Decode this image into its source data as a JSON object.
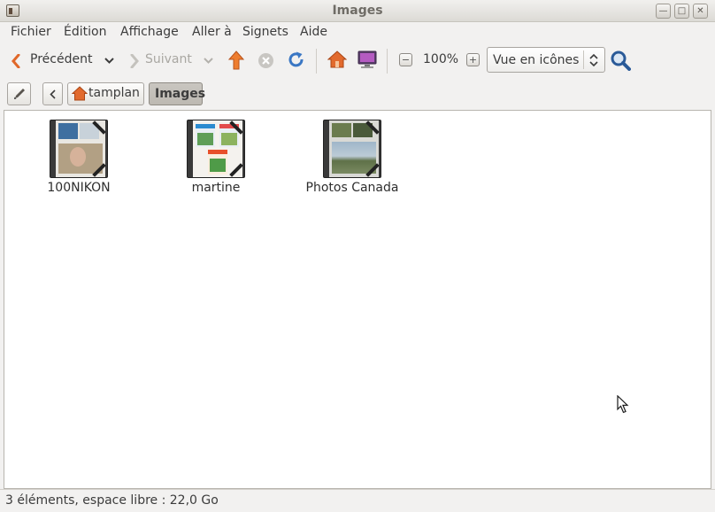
{
  "window": {
    "title": "Images"
  },
  "menu": [
    "Fichier",
    "Édition",
    "Affichage",
    "Aller à",
    "Signets",
    "Aide"
  ],
  "toolbar": {
    "back_label": "Précédent",
    "forward_label": "Suivant",
    "zoom_level": "100%",
    "view_mode": "Vue en icônes"
  },
  "pathbar": {
    "home": "tamplan",
    "current": "Images"
  },
  "items": [
    {
      "name": "100NIKON"
    },
    {
      "name": "martine"
    },
    {
      "name": "Photos Canada"
    }
  ],
  "status": "3 éléments, espace libre : 22,0 Go",
  "colors": {
    "accent_orange": "#e0682a",
    "home_orange": "#e26a2d",
    "reload_blue": "#3a77c4"
  }
}
